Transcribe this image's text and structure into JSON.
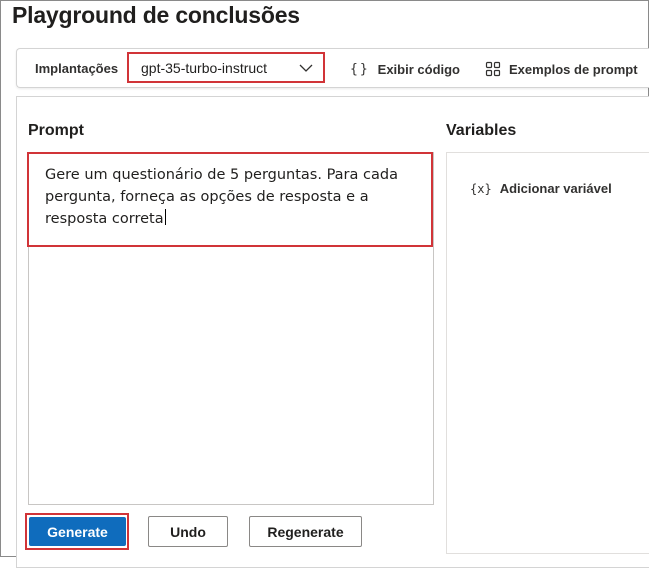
{
  "page_title": "Playground de conclusões",
  "toolbar": {
    "deployments_label": "Implantações",
    "deployment_value": "gpt-35-turbo-instruct",
    "view_code_label": "Exibir código",
    "prompt_examples_label": "Exemplos de prompt"
  },
  "prompt": {
    "title": "Prompt",
    "text": "Gere um questionário de 5 perguntas. Para cada pergunta, forneça as opções de resposta e a resposta correta"
  },
  "variables": {
    "title": "Variables",
    "add_label": "Adicionar variável"
  },
  "actions": {
    "generate_label": "Generate",
    "undo_label": "Undo",
    "regenerate_label": "Regenerate"
  },
  "colors": {
    "highlight": "#d13438",
    "primary": "#0f6cbd"
  },
  "icons": {
    "dropdown": "chevron-down-icon",
    "code": "braces-icon",
    "examples": "grid-icon",
    "variable": "variable-icon"
  }
}
